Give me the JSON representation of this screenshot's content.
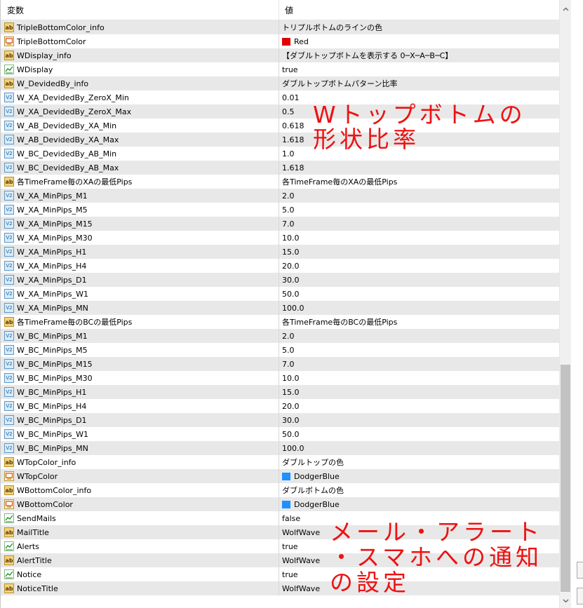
{
  "header": {
    "name_label": "変数",
    "value_label": "値"
  },
  "rows": [
    {
      "icon": "ab",
      "name": "TripleBottomColor_info",
      "value": "トリプルボトムのラインの色"
    },
    {
      "icon": "color",
      "name": "TripleBottomColor",
      "value": "Red",
      "swatch": "#e00000"
    },
    {
      "icon": "ab",
      "name": "WDisplay_info",
      "value": "【ダブルトップボトムを表示する 0─X─A─B─C】"
    },
    {
      "icon": "bool",
      "name": "WDisplay",
      "value": "true"
    },
    {
      "icon": "ab",
      "name": "W_DevidedBy_info",
      "value": "ダブルトップボトムパターン比率"
    },
    {
      "icon": "v",
      "name": "W_XA_DevidedBy_ZeroX_Min",
      "value": "0.01"
    },
    {
      "icon": "v",
      "name": "W_XA_DevidedBy_ZeroX_Max",
      "value": "0.5"
    },
    {
      "icon": "v",
      "name": "W_AB_DevidedBy_XA_Min",
      "value": "0.618"
    },
    {
      "icon": "v",
      "name": "W_AB_DevidedBy_XA_Max",
      "value": "1.618"
    },
    {
      "icon": "v",
      "name": "W_BC_DevidedBy_AB_Min",
      "value": "1.0"
    },
    {
      "icon": "v",
      "name": "W_BC_DevidedBy_AB_Max",
      "value": "1.618"
    },
    {
      "icon": "ab",
      "name": "各TimeFrame毎のXAの最低Pips",
      "value": "各TimeFrame毎のXAの最低Pips"
    },
    {
      "icon": "v",
      "name": "W_XA_MinPips_M1",
      "value": "2.0"
    },
    {
      "icon": "v",
      "name": "W_XA_MinPips_M5",
      "value": "5.0"
    },
    {
      "icon": "v",
      "name": "W_XA_MinPips_M15",
      "value": "7.0"
    },
    {
      "icon": "v",
      "name": "W_XA_MinPips_M30",
      "value": "10.0"
    },
    {
      "icon": "v",
      "name": "W_XA_MinPips_H1",
      "value": "15.0"
    },
    {
      "icon": "v",
      "name": "W_XA_MinPips_H4",
      "value": "20.0"
    },
    {
      "icon": "v",
      "name": "W_XA_MinPips_D1",
      "value": "30.0"
    },
    {
      "icon": "v",
      "name": "W_XA_MinPips_W1",
      "value": "50.0"
    },
    {
      "icon": "v",
      "name": "W_XA_MinPips_MN",
      "value": "100.0"
    },
    {
      "icon": "ab",
      "name": "各TimeFrame毎のBCの最低Pips",
      "value": "各TimeFrame毎のBCの最低Pips"
    },
    {
      "icon": "v",
      "name": "W_BC_MinPips_M1",
      "value": "2.0"
    },
    {
      "icon": "v",
      "name": "W_BC_MinPips_M5",
      "value": "5.0"
    },
    {
      "icon": "v",
      "name": "W_BC_MinPips_M15",
      "value": "7.0"
    },
    {
      "icon": "v",
      "name": "W_BC_MinPips_M30",
      "value": "10.0"
    },
    {
      "icon": "v",
      "name": "W_BC_MinPips_H1",
      "value": "15.0"
    },
    {
      "icon": "v",
      "name": "W_BC_MinPips_H4",
      "value": "20.0"
    },
    {
      "icon": "v",
      "name": "W_BC_MinPips_D1",
      "value": "30.0"
    },
    {
      "icon": "v",
      "name": "W_BC_MinPips_W1",
      "value": "50.0"
    },
    {
      "icon": "v",
      "name": "W_BC_MinPips_MN",
      "value": "100.0"
    },
    {
      "icon": "ab",
      "name": "WTopColor_info",
      "value": "ダブルトップの色"
    },
    {
      "icon": "color",
      "name": "WTopColor",
      "value": "DodgerBlue",
      "swatch": "#1e90ff"
    },
    {
      "icon": "ab",
      "name": "WBottomColor_info",
      "value": "ダブルボトムの色"
    },
    {
      "icon": "color",
      "name": "WBottomColor",
      "value": "DodgerBlue",
      "swatch": "#1e90ff"
    },
    {
      "icon": "bool",
      "name": "SendMails",
      "value": "false"
    },
    {
      "icon": "ab",
      "name": "MailTitle",
      "value": "WolfWave"
    },
    {
      "icon": "bool",
      "name": "Alerts",
      "value": "true"
    },
    {
      "icon": "ab",
      "name": "AlertTitle",
      "value": "WolfWave"
    },
    {
      "icon": "bool",
      "name": "Notice",
      "value": "true"
    },
    {
      "icon": "ab",
      "name": "NoticeTitle",
      "value": "WolfWave"
    }
  ],
  "annotations": {
    "shape_ratio_line1": "Wトップボトムの",
    "shape_ratio_line2": "形状比率",
    "notify_line1": "メール・アラート",
    "notify_line2": "・スマホへの通知",
    "notify_line3": "の設定"
  },
  "icons": {
    "ab": "ab",
    "v": "V2"
  },
  "colors": {
    "annotation": "#ee1111",
    "row_alt": "#e8e8e8",
    "scroll_thumb": "#c2c2c2"
  }
}
